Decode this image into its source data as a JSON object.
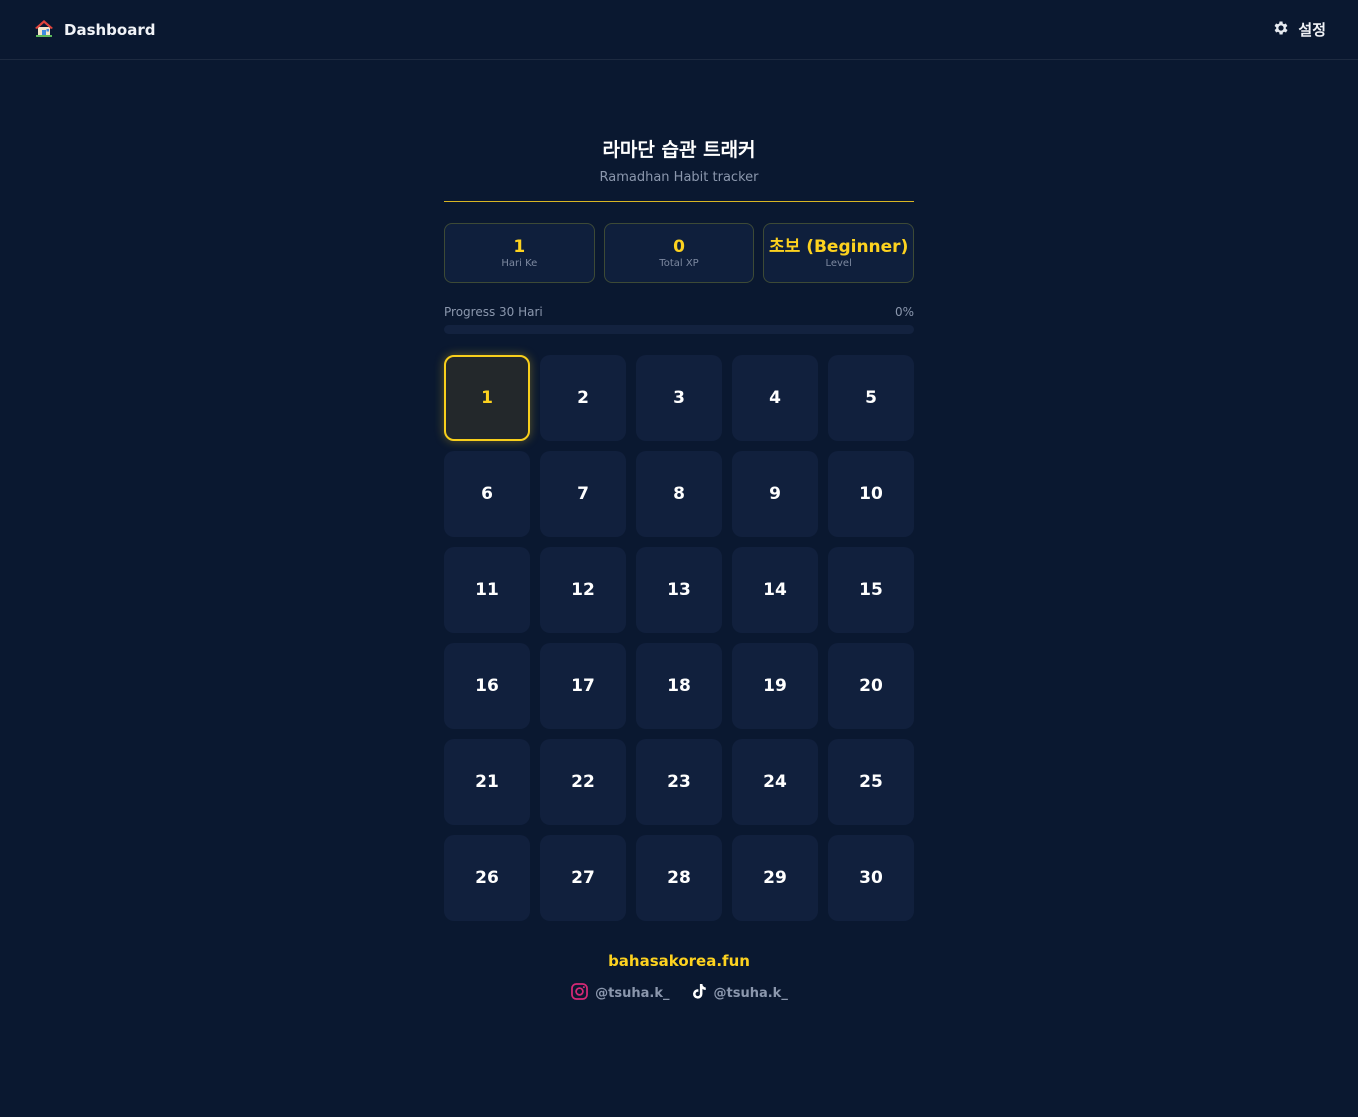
{
  "header": {
    "brand_label": "Dashboard",
    "settings_label": "설정"
  },
  "page": {
    "title": "라마단 습관 트래커",
    "subtitle": "Ramadhan Habit tracker"
  },
  "stats": [
    {
      "value": "1",
      "label": "Hari Ke"
    },
    {
      "value": "0",
      "label": "Total XP"
    },
    {
      "value": "초보 (Beginner)",
      "label": "Level"
    }
  ],
  "progress": {
    "label": "Progress 30 Hari",
    "percent_text": "0%",
    "value": 0
  },
  "days": [
    "1",
    "2",
    "3",
    "4",
    "5",
    "6",
    "7",
    "8",
    "9",
    "10",
    "11",
    "12",
    "13",
    "14",
    "15",
    "16",
    "17",
    "18",
    "19",
    "20",
    "21",
    "22",
    "23",
    "24",
    "25",
    "26",
    "27",
    "28",
    "29",
    "30"
  ],
  "active_day": "1",
  "footer": {
    "site": "bahasakorea.fun",
    "instagram": "@tsuha.k_",
    "tiktok": "@tsuha.k_"
  },
  "colors": {
    "background": "#0a1830",
    "accent": "#fdd21f",
    "tile": "#11203d",
    "instagram": "#d62976"
  },
  "icons": {
    "brand": "house-icon",
    "settings": "gear-icon",
    "instagram": "instagram-icon",
    "tiktok": "tiktok-icon"
  }
}
